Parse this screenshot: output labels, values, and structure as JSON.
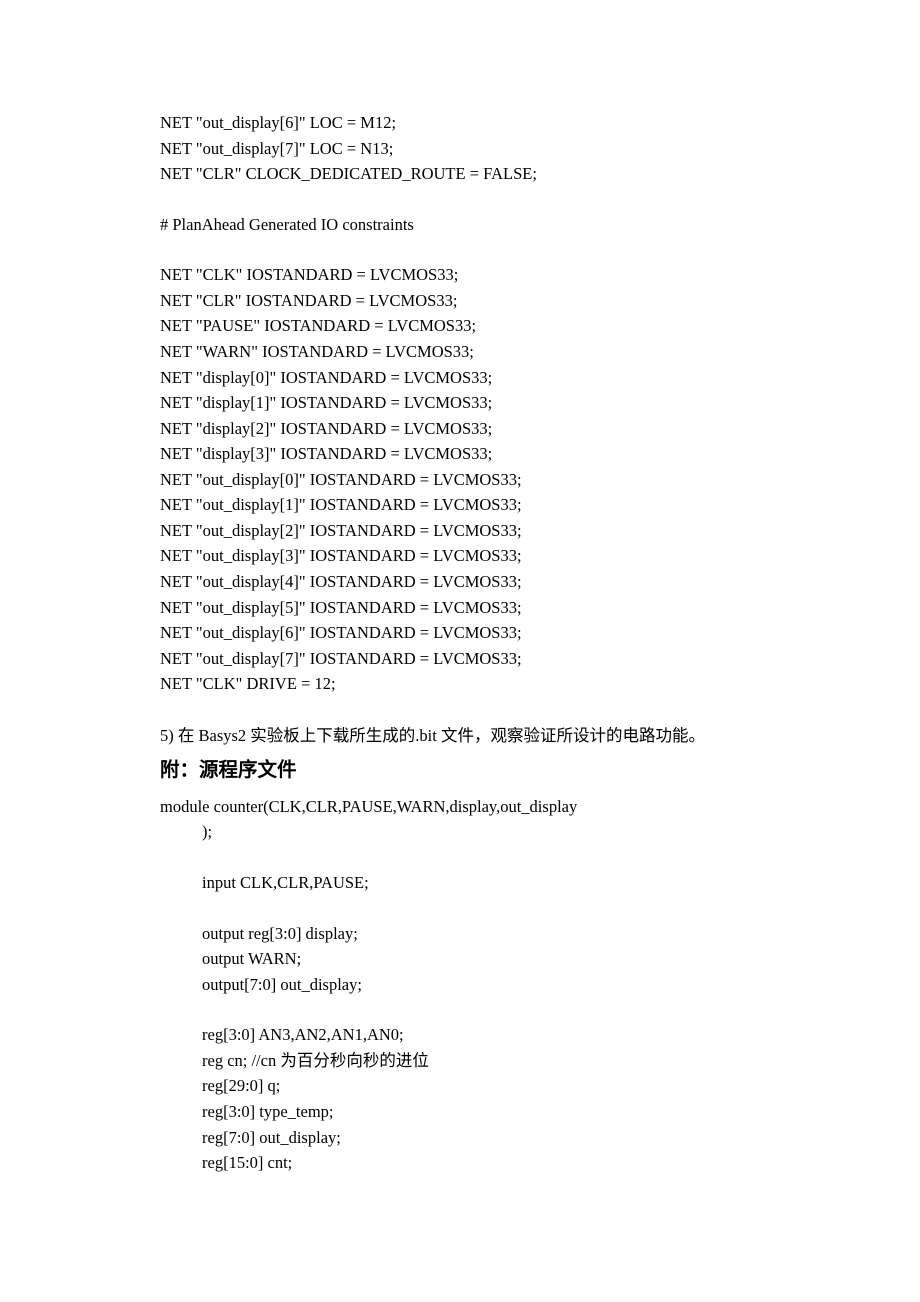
{
  "block1": {
    "lines": [
      "NET \"out_display[6]\" LOC = M12;",
      "NET \"out_display[7]\" LOC = N13;",
      "NET \"CLR\" CLOCK_DEDICATED_ROUTE = FALSE;"
    ]
  },
  "comment1": "# PlanAhead Generated IO constraints",
  "block2": {
    "lines": [
      "NET \"CLK\" IOSTANDARD = LVCMOS33;",
      "NET \"CLR\" IOSTANDARD = LVCMOS33;",
      "NET \"PAUSE\" IOSTANDARD = LVCMOS33;",
      "NET \"WARN\" IOSTANDARD = LVCMOS33;",
      "NET \"display[0]\" IOSTANDARD = LVCMOS33;",
      "NET \"display[1]\" IOSTANDARD = LVCMOS33;",
      "NET \"display[2]\" IOSTANDARD = LVCMOS33;",
      "NET \"display[3]\" IOSTANDARD = LVCMOS33;",
      "NET \"out_display[0]\" IOSTANDARD = LVCMOS33;",
      "NET \"out_display[1]\" IOSTANDARD = LVCMOS33;",
      "NET \"out_display[2]\" IOSTANDARD = LVCMOS33;",
      "NET \"out_display[3]\" IOSTANDARD = LVCMOS33;",
      "NET \"out_display[4]\" IOSTANDARD = LVCMOS33;",
      "NET \"out_display[5]\" IOSTANDARD = LVCMOS33;",
      "NET \"out_display[6]\" IOSTANDARD = LVCMOS33;",
      "NET \"out_display[7]\" IOSTANDARD = LVCMOS33;",
      "NET \"CLK\" DRIVE = 12;"
    ]
  },
  "step5": "5)    在 Basys2 实验板上下载所生成的.bit 文件，观察验证所设计的电路功能。",
  "heading": "附：源程序文件",
  "module_line1": "module counter(CLK,CLR,PAUSE,WARN,display,out_display",
  "module_line2": ");",
  "decls": {
    "group1": [
      "input CLK,CLR,PAUSE;"
    ],
    "group2": [
      "output reg[3:0] display;",
      "output WARN;",
      "output[7:0] out_display;"
    ],
    "group3": [
      "reg[3:0] AN3,AN2,AN1,AN0;",
      "reg cn; //cn 为百分秒向秒的进位",
      "reg[29:0] q;",
      "reg[3:0] type_temp;",
      "reg[7:0] out_display;",
      "reg[15:0] cnt;"
    ]
  }
}
